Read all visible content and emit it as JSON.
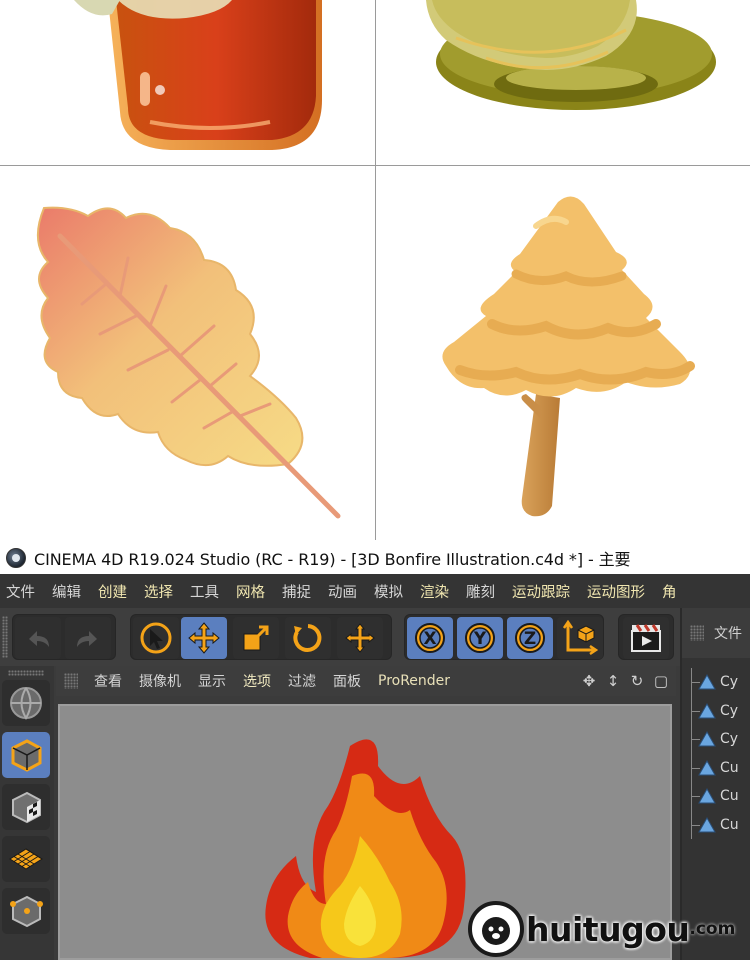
{
  "window": {
    "title": "CINEMA 4D R19.024 Studio (RC - R19) - [3D Bonfire Illustration.c4d *] - 主要"
  },
  "menubar": {
    "items": [
      "文件",
      "编辑",
      "创建",
      "选择",
      "工具",
      "网格",
      "捕捉",
      "动画",
      "模拟",
      "渲染",
      "雕刻",
      "运动跟踪",
      "运动图形",
      "角"
    ]
  },
  "toolbar": {
    "mode_icons": [
      "select-arrow-icon",
      "move-icon",
      "scale-icon",
      "rotate-icon",
      "last-tool-icon"
    ],
    "axis_locks": [
      "X",
      "Y",
      "Z"
    ],
    "active": "move-icon"
  },
  "viewport_menu": {
    "items": [
      "查看",
      "摄像机",
      "显示",
      "选项",
      "过滤",
      "面板",
      "ProRender"
    ]
  },
  "object_manager": {
    "header": "文件",
    "objects": [
      "Cy",
      "Cy",
      "Cy",
      "Cu",
      "Cu",
      "Cu"
    ]
  },
  "watermark": {
    "name": "huitugou",
    "domain": ".com"
  },
  "colors": {
    "accent_blue": "#5b7fbf",
    "icon_orange": "#f4a318",
    "ui_dark": "#3b3b3b"
  }
}
